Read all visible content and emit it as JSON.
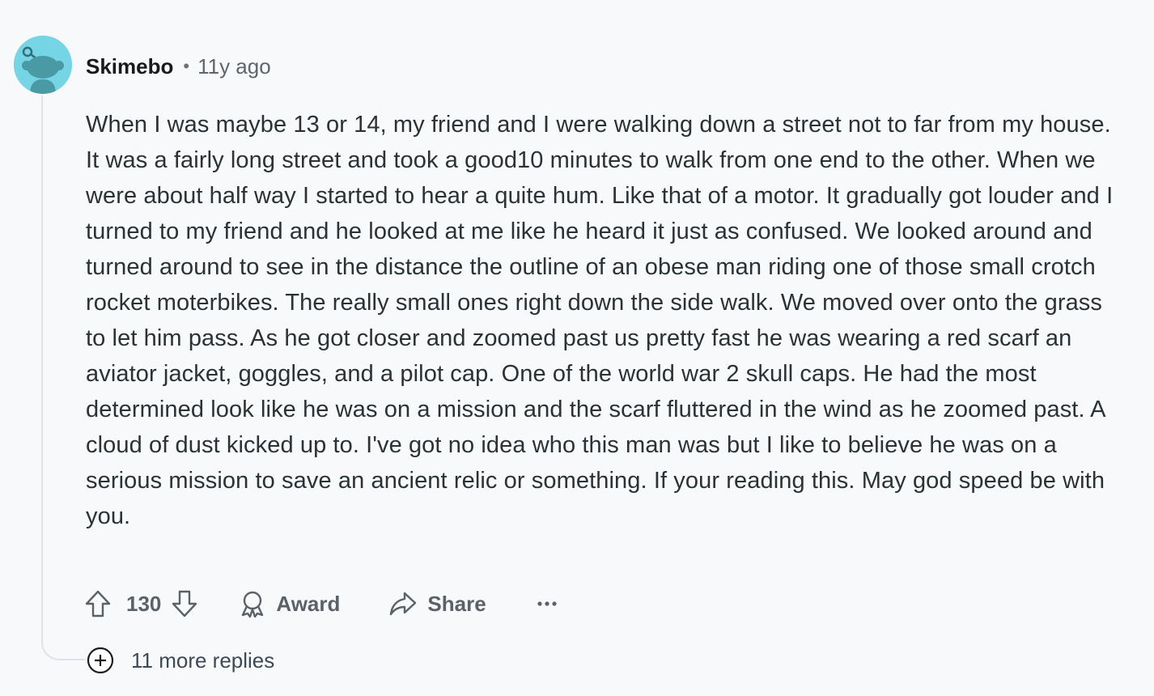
{
  "comment": {
    "username": "Skimebo",
    "separator": "•",
    "timestamp": "11y ago",
    "body": "When I was maybe 13 or 14, my friend and I were walking down a street not to far from my house. It was a fairly long street and took a good10 minutes to walk from one end to the other. When we were about half way I started to hear a quite hum. Like that of a motor. It gradually got louder and I turned to my friend and he looked at me like he heard it just as confused. We looked around and turned around to see in the distance the outline of an obese man riding one of those small crotch rocket moterbikes. The really small ones right down the side walk. We moved over onto the grass to let him pass. As he got closer and zoomed past us pretty fast he was wearing a red scarf an aviator jacket, goggles, and a pilot cap. One of the world war 2 skull caps. He had the most determined look like he was on a mission and the scarf fluttered in the wind as he zoomed past. A cloud of dust kicked up to. I've got no idea who this man was but I like to believe he was on a serious mission to save an ancient relic or something. If your reading this. May god speed be with you."
  },
  "actions": {
    "vote_count": "130",
    "award_label": "Award",
    "share_label": "Share",
    "more_label": "•••"
  },
  "replies": {
    "label": "11 more replies"
  },
  "colors": {
    "background": "#f8f9fb",
    "avatar_bg": "#76d5e4",
    "text": "#2a3236",
    "muted": "#5a6268",
    "thread_line": "#dfe3e7"
  },
  "icons": [
    "avatar-snoo-icon",
    "upvote-arrow-icon",
    "downvote-arrow-icon",
    "award-icon",
    "share-arrow-icon",
    "more-options-icon",
    "expand-plus-icon"
  ]
}
